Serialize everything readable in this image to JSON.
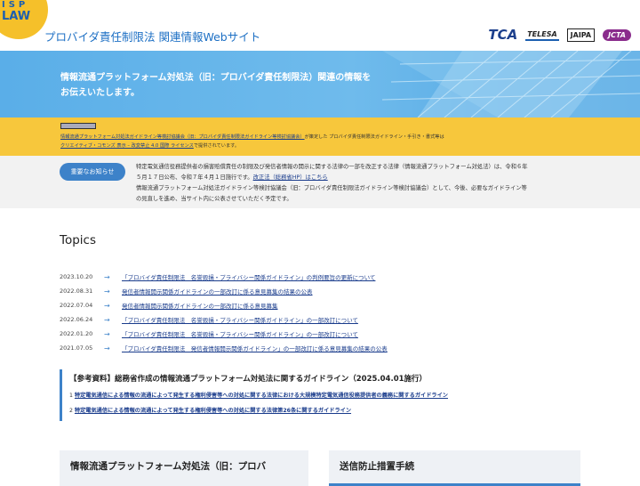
{
  "header": {
    "logo_line1": "ISP",
    "logo_line2": "LAW",
    "site_title": "プロバイダ責任制限法 関連情報Webサイト",
    "partners": [
      "TCA",
      "TELESA",
      "JAIPA",
      "JCTA"
    ]
  },
  "hero": {
    "line1": "情報流通プラットフォーム対処法（旧：プロバイダ責任制限法）関連の情報を",
    "line2": "お伝えいたします。"
  },
  "license": {
    "badge": "cc by-nd",
    "link1": "情報流通プラットフォーム対処法ガイドライン等検討協議会（旧：プロバイダ責任制限法ガイドライン等検討協議会）",
    "text1": "が策定した プロバイダ責任制限法ガイドライン・手引き・書式等は",
    "link2": "クリエイティブ・コモンズ 表示 – 改変禁止 4.0 国際 ライセンス",
    "text2": "で提供されています。"
  },
  "notice": {
    "button": "重要なお知らせ",
    "line1": "特定電気通信役務提供者の損害賠償責任の制限及び発信者情報の開示に関する法律の一部を改正する法律（情報流通プラットフォーム対処法）は、令和６年",
    "line2": "５月１７日公布、令和７年４月１日施行です。",
    "line2_link": "改正法（総務省HP）はこちら",
    "line3": "情報流通プラットフォーム対処法ガイドライン等検討協議会（旧：プロバイダ責任制限法ガイドライン等検討協議会）として、今後、必要なガイドライン等",
    "line4": "の見直しを進め、当サイト内に公表させていただく予定です。"
  },
  "topics": {
    "heading": "Topics",
    "items": [
      {
        "date": "2023.10.20",
        "arrow": "→",
        "text": "「プロバイダ責任制限法　名誉毀損・プライバシー関係ガイドライン」の判例要旨の更新について"
      },
      {
        "date": "2022.08.31",
        "arrow": "→",
        "text": "発信者情報開示関係ガイドラインの一部改訂に係る意見募集の結果の公表"
      },
      {
        "date": "2022.07.04",
        "arrow": "→",
        "text": "発信者情報開示関係ガイドラインの一部改訂に係る意見募集"
      },
      {
        "date": "2022.06.24",
        "arrow": "→",
        "text": "「プロバイダ責任制限法　名誉毀損・プライバシー関係ガイドライン」の一部改訂について"
      },
      {
        "date": "2022.01.20",
        "arrow": "→",
        "text": "「プロバイダ責任制限法　名誉毀損・プライバシー関係ガイドライン」の一部改訂について"
      },
      {
        "date": "2021.07.05",
        "arrow": "→",
        "text": "「プロバイダ責任制限法　発信者情報開示関係ガイドライン」の一部改訂に係る意見募集の結果の公表"
      }
    ]
  },
  "reference": {
    "title": "【参考資料】総務省作成の情報流通プラットフォーム対処法に関するガイドライン（2025.04.01施行）",
    "items": [
      {
        "num": "1",
        "text": "特定電気通信による情報の流通によって発生する権利侵害等への対処に関する法律における大規模特定電気通信役務提供者の義務に関するガイドライン"
      },
      {
        "num": "2",
        "text": "特定電気通信による情報の流通によって発生する権利侵害等への対処に関する法律第26条に関するガイドライン"
      }
    ]
  },
  "boxes": {
    "left_title": "情報流通プラットフォーム対処法（旧：プロバ",
    "right_title": "送信防止措置手続"
  }
}
